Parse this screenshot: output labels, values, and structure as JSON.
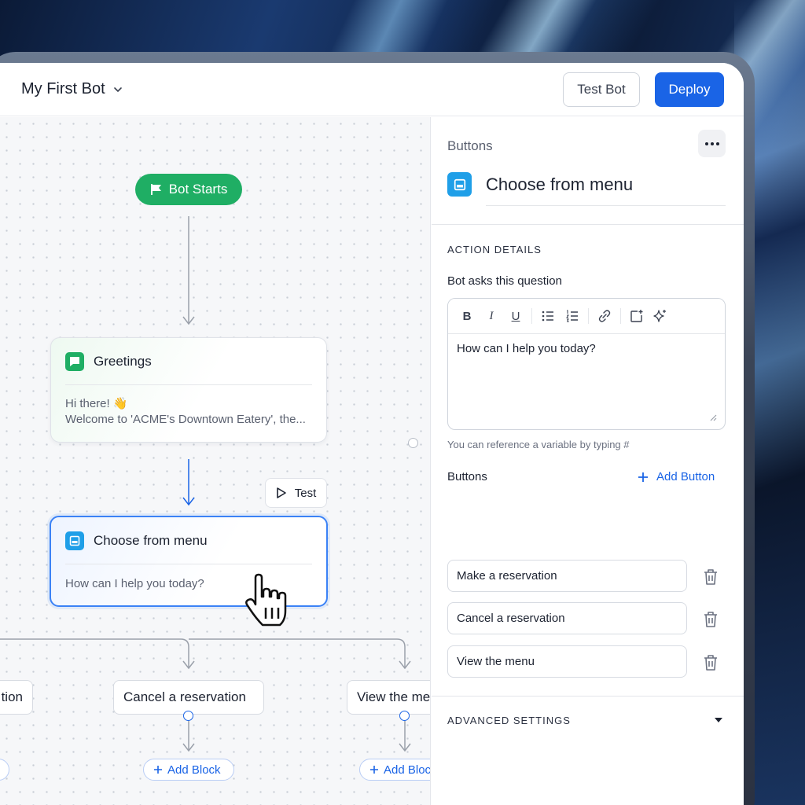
{
  "header": {
    "bot_name": "My First Bot",
    "test_bot_label": "Test Bot",
    "deploy_label": "Deploy"
  },
  "canvas": {
    "start_label": "Bot Starts",
    "greeting_node": {
      "title": "Greetings",
      "line1": "Hi there! 👋",
      "line2": "Welcome to 'ACME's Downtown Eatery', the..."
    },
    "test_chip_label": "Test",
    "menu_node": {
      "title": "Choose from menu",
      "body": "How can I help you today?"
    },
    "options": [
      "tion",
      "Cancel a reservation",
      "View the me"
    ],
    "add_block_label": "Add Block",
    "add_block_label_clipped": "Add Bloc"
  },
  "panel": {
    "crumb": "Buttons",
    "title": "Choose from menu",
    "action_details_heading": "ACTION DETAILS",
    "question_label": "Bot asks this question",
    "question_text": "How can I help you today?",
    "hint": "You can reference a variable by typing #",
    "buttons_label": "Buttons",
    "add_button_label": "Add Button",
    "buttons": [
      "Make a reservation",
      "Cancel a reservation",
      "View the menu"
    ],
    "advanced_heading": "ADVANCED SETTINGS"
  },
  "colors": {
    "accent": "#1a64e6",
    "start_green": "#1fae64",
    "node_icon_blue": "#1f9fe8"
  },
  "icons": [
    "chevron-down-icon",
    "flag-icon",
    "chat-icon",
    "menu-block-icon",
    "play-icon",
    "plus-icon",
    "trash-icon",
    "more-icon",
    "hand-cursor-icon"
  ]
}
